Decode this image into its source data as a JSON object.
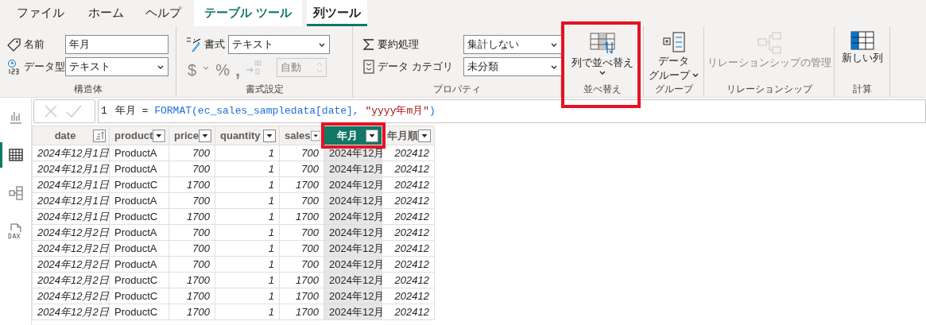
{
  "tabs": [
    {
      "label": "ファイル",
      "kind": "normal",
      "selected": false
    },
    {
      "label": "ホーム",
      "kind": "normal",
      "selected": false
    },
    {
      "label": "ヘルプ",
      "kind": "normal",
      "selected": false
    },
    {
      "label": "テーブル ツール",
      "kind": "contextual",
      "selected": false
    },
    {
      "label": "列ツール",
      "kind": "contextual",
      "selected": true
    }
  ],
  "ribbon": {
    "structure": {
      "name_label": "名前",
      "name_value": "年月",
      "type_label": "データ型",
      "type_value": "テキスト",
      "caption": "構造体"
    },
    "formatting": {
      "format_label": "書式",
      "format_value": "テキスト",
      "currency": "$",
      "percent": "%",
      "comma": ",",
      "decimals_placeholder": "自動",
      "disabled": true,
      "caption": "書式設定"
    },
    "properties": {
      "summary_label": "要約処理",
      "summary_value": "集計しない",
      "category_label": "データ カテゴリ",
      "category_value": "未分類",
      "caption": "プロパティ"
    },
    "sort": {
      "label": "列で並べ替え",
      "caption": "並べ替え",
      "highlighted": true
    },
    "groups": {
      "label_line1": "データ",
      "label_line2": "グループ",
      "has_menu": true,
      "caption": "グループ"
    },
    "relationships": {
      "label": "リレーションシップの管理",
      "disabled": true,
      "caption": "リレーションシップ"
    },
    "calculations": {
      "label": "新しい列",
      "caption": "計算"
    }
  },
  "sidebar": [
    {
      "kind": "report",
      "selected": false
    },
    {
      "kind": "table",
      "selected": true
    },
    {
      "kind": "model",
      "selected": false
    },
    {
      "kind": "dax",
      "selected": false
    }
  ],
  "formula": {
    "line": "1",
    "segments": [
      {
        "kind": "name",
        "text": "年月 = "
      },
      {
        "kind": "code",
        "text": "FORMAT(ec_sales_sampledata[date], "
      },
      {
        "kind": "string",
        "text": "\"yyyy年m月\""
      },
      {
        "kind": "code",
        "text": ")"
      }
    ]
  },
  "table": {
    "columns": [
      {
        "name": "date",
        "kind": "date",
        "sort": true,
        "selected": false,
        "highlighted": false
      },
      {
        "name": "product",
        "kind": "text",
        "sort": false,
        "selected": false,
        "highlighted": false
      },
      {
        "name": "price",
        "kind": "number",
        "sort": false,
        "selected": false,
        "highlighted": false
      },
      {
        "name": "quantity",
        "kind": "number",
        "sort": false,
        "selected": false,
        "highlighted": false
      },
      {
        "name": "sales",
        "kind": "number",
        "sort": false,
        "selected": false,
        "highlighted": false
      },
      {
        "name": "年月",
        "kind": "text",
        "sort": false,
        "selected": true,
        "highlighted": true
      },
      {
        "name": "年月順",
        "kind": "number",
        "sort": false,
        "selected": false,
        "highlighted": false
      }
    ],
    "rows": [
      [
        "2024年12月1日",
        "ProductA",
        "700",
        "1",
        "700",
        "2024年12月",
        "202412"
      ],
      [
        "2024年12月1日",
        "ProductA",
        "700",
        "1",
        "700",
        "2024年12月",
        "202412"
      ],
      [
        "2024年12月1日",
        "ProductC",
        "1700",
        "1",
        "1700",
        "2024年12月",
        "202412"
      ],
      [
        "2024年12月1日",
        "ProductA",
        "700",
        "1",
        "700",
        "2024年12月",
        "202412"
      ],
      [
        "2024年12月1日",
        "ProductC",
        "1700",
        "1",
        "1700",
        "2024年12月",
        "202412"
      ],
      [
        "2024年12月2日",
        "ProductA",
        "700",
        "1",
        "700",
        "2024年12月",
        "202412"
      ],
      [
        "2024年12月2日",
        "ProductA",
        "700",
        "1",
        "700",
        "2024年12月",
        "202412"
      ],
      [
        "2024年12月2日",
        "ProductA",
        "700",
        "1",
        "700",
        "2024年12月",
        "202412"
      ],
      [
        "2024年12月2日",
        "ProductC",
        "1700",
        "1",
        "1700",
        "2024年12月",
        "202412"
      ],
      [
        "2024年12月2日",
        "ProductC",
        "1700",
        "1",
        "1700",
        "2024年12月",
        "202412"
      ],
      [
        "2024年12月2日",
        "ProductC",
        "1700",
        "1",
        "1700",
        "2024年12月",
        "202412"
      ]
    ]
  }
}
